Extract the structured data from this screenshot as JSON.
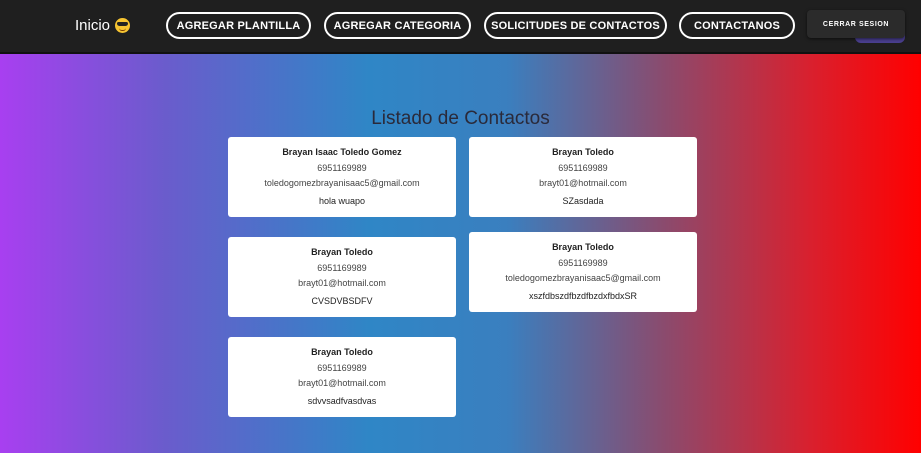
{
  "nav": {
    "brand": "Inicio",
    "brand_icon": "sunglasses-emoji-icon",
    "buttons": [
      "AGREGAR PLANTILLA",
      "AGREGAR CATEGORIA",
      "SOLICITUDES DE CONTACTOS",
      "CONTACTANOS"
    ],
    "logout": "CERRAR SESION"
  },
  "page": {
    "title": "Listado de Contactos"
  },
  "contacts": [
    {
      "name": "Brayan Isaac Toledo Gomez",
      "phone": "6951169989",
      "email": "toledogomezbrayanisaac5@gmail.com",
      "message": "hola wuapo"
    },
    {
      "name": "Brayan Toledo",
      "phone": "6951169989",
      "email": "brayt01@hotmail.com",
      "message": "SZasdada"
    },
    {
      "name": "Brayan Toledo",
      "phone": "6951169989",
      "email": "brayt01@hotmail.com",
      "message": "CVSDVBSDFV"
    },
    {
      "name": "Brayan Toledo",
      "phone": "6951169989",
      "email": "toledogomezbrayanisaac5@gmail.com",
      "message": "xszfdbszdfbzdfbzdxfbdxSR"
    },
    {
      "name": "Brayan Toledo",
      "phone": "6951169989",
      "email": "brayt01@hotmail.com",
      "message": "sdvvsadfvasdvas"
    }
  ],
  "colors": {
    "navbar": "#1f1f1f",
    "gradient_left": "#a83ff0",
    "gradient_mid": "#2f86c6",
    "gradient_right": "#ff0000"
  }
}
